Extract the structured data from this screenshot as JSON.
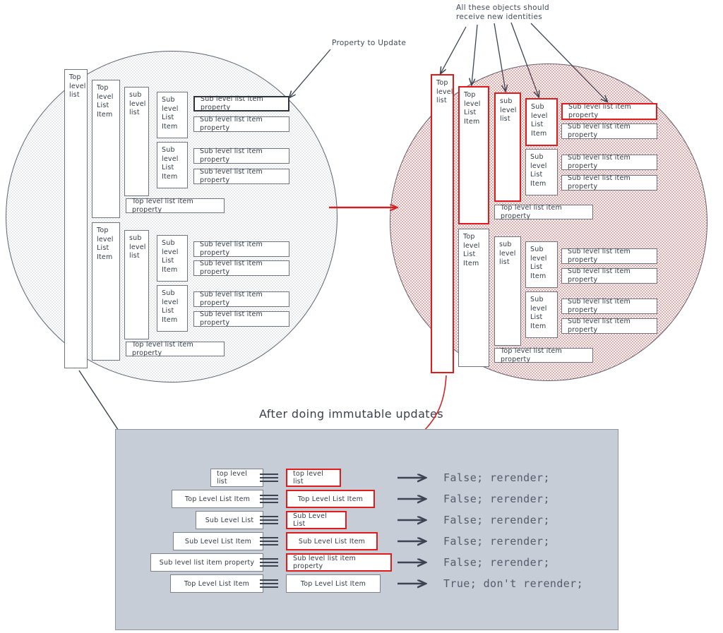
{
  "annotations": {
    "property_to_update": "Property to Update",
    "new_identities": "All these objects should\nreceive new identities",
    "panel_title": "After doing immutable updates"
  },
  "labels": {
    "top_level_list": "Top\nlevel\nlist",
    "top_level_list_item": "Top\nlevel\nList\nItem",
    "sub_level_list": "sub\nlevel\nlist",
    "sub_level_list_item": "Sub\nlevel\nList\nItem",
    "sub_level_list_item_property": "Sub level list item property",
    "top_level_list_item_property": "Top level list item property"
  },
  "colors": {
    "highlight_red": "#e01b1b",
    "outline_gray": "#6c7482",
    "left_circle_fill": "#e9eaee",
    "right_circle_fill": "#f2a6a6",
    "panel_fill": "#c6cdd7",
    "result_text": "#555c68"
  },
  "left_tree": {
    "root": "Top\nlevel\nlist",
    "branches": [
      {
        "item": "Top\nlevel\nList\nItem",
        "sub_list": "sub\nlevel\nlist",
        "sub_items": [
          {
            "label": "Sub\nlevel\nList\nItem",
            "properties": [
              "Sub level list item property",
              "Sub level list item property"
            ]
          },
          {
            "label": "Sub\nlevel\nList\nItem",
            "properties": [
              "Sub level list item property",
              "Sub level list item property"
            ]
          }
        ],
        "item_property": "Top level list item property"
      },
      {
        "item": "Top\nlevel\nList\nItem",
        "sub_list": "sub\nlevel\nlist",
        "sub_items": [
          {
            "label": "Sub\nlevel\nList\nItem",
            "properties": [
              "Sub level list item property",
              "Sub level list item property"
            ]
          },
          {
            "label": "Sub\nlevel\nList\nItem",
            "properties": [
              "Sub level list item property",
              "Sub level list item property"
            ]
          }
        ],
        "item_property": "Top level list item property"
      }
    ]
  },
  "right_tree": {
    "root": "Top\nlevel\nlist",
    "branches": [
      {
        "item": "Top\nlevel\nList\nItem",
        "sub_list": "sub\nlevel\nlist",
        "sub_items": [
          {
            "label": "Sub\nlevel\nList\nItem",
            "properties": [
              "Sub level list item property",
              "Sub level list item property"
            ]
          },
          {
            "label": "Sub\nlevel\nList\nItem",
            "properties": [
              "Sub level list item property",
              "Sub level list item property"
            ]
          }
        ],
        "item_property": "Top level list item property"
      },
      {
        "item": "Top\nlevel\nList\nItem",
        "sub_list": "sub\nlevel\nlist",
        "sub_items": [
          {
            "label": "Sub\nlevel\nList\nItem",
            "properties": [
              "Sub level list item property",
              "Sub level list item property"
            ]
          },
          {
            "label": "Sub\nlevel\nList\nItem",
            "properties": [
              "Sub level list item property",
              "Sub level list item property"
            ]
          }
        ],
        "item_property": "Top level list item property"
      }
    ]
  },
  "comparison": {
    "operator": "===",
    "rows": [
      {
        "left": "top level list",
        "right": "top level list",
        "right_changed": true,
        "result": "False; rerender;"
      },
      {
        "left": "Top Level List Item",
        "right": "Top Level List Item",
        "right_changed": true,
        "result": "False; rerender;"
      },
      {
        "left": "Sub Level List",
        "right": "Sub Level List",
        "right_changed": true,
        "result": "False; rerender;"
      },
      {
        "left": "Sub Level List Item",
        "right": "Sub Level List Item",
        "right_changed": true,
        "result": "False; rerender;"
      },
      {
        "left": "Sub level list item property",
        "right": "Sub level list item property",
        "right_changed": true,
        "result": "False; rerender;"
      },
      {
        "left": "Top Level List Item",
        "right": "Top Level List Item",
        "right_changed": false,
        "result": "True; don't rerender;"
      }
    ]
  }
}
